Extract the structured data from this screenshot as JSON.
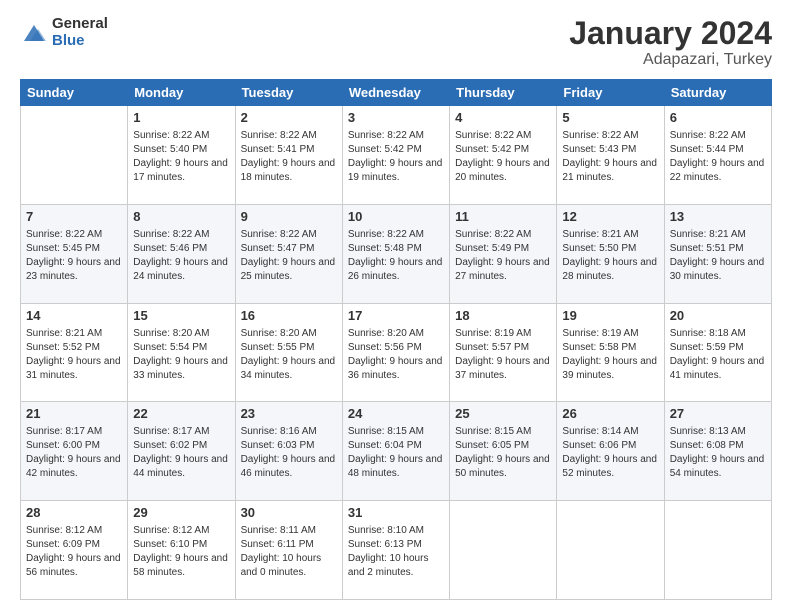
{
  "logo": {
    "general": "General",
    "blue": "Blue"
  },
  "title": {
    "month": "January 2024",
    "location": "Adapazari, Turkey"
  },
  "days": [
    "Sunday",
    "Monday",
    "Tuesday",
    "Wednesday",
    "Thursday",
    "Friday",
    "Saturday"
  ],
  "weeks": [
    [
      {
        "day": "",
        "sunrise": "",
        "sunset": "",
        "daylight": ""
      },
      {
        "day": "1",
        "sunrise": "Sunrise: 8:22 AM",
        "sunset": "Sunset: 5:40 PM",
        "daylight": "Daylight: 9 hours and 17 minutes."
      },
      {
        "day": "2",
        "sunrise": "Sunrise: 8:22 AM",
        "sunset": "Sunset: 5:41 PM",
        "daylight": "Daylight: 9 hours and 18 minutes."
      },
      {
        "day": "3",
        "sunrise": "Sunrise: 8:22 AM",
        "sunset": "Sunset: 5:42 PM",
        "daylight": "Daylight: 9 hours and 19 minutes."
      },
      {
        "day": "4",
        "sunrise": "Sunrise: 8:22 AM",
        "sunset": "Sunset: 5:42 PM",
        "daylight": "Daylight: 9 hours and 20 minutes."
      },
      {
        "day": "5",
        "sunrise": "Sunrise: 8:22 AM",
        "sunset": "Sunset: 5:43 PM",
        "daylight": "Daylight: 9 hours and 21 minutes."
      },
      {
        "day": "6",
        "sunrise": "Sunrise: 8:22 AM",
        "sunset": "Sunset: 5:44 PM",
        "daylight": "Daylight: 9 hours and 22 minutes."
      }
    ],
    [
      {
        "day": "7",
        "sunrise": "Sunrise: 8:22 AM",
        "sunset": "Sunset: 5:45 PM",
        "daylight": "Daylight: 9 hours and 23 minutes."
      },
      {
        "day": "8",
        "sunrise": "Sunrise: 8:22 AM",
        "sunset": "Sunset: 5:46 PM",
        "daylight": "Daylight: 9 hours and 24 minutes."
      },
      {
        "day": "9",
        "sunrise": "Sunrise: 8:22 AM",
        "sunset": "Sunset: 5:47 PM",
        "daylight": "Daylight: 9 hours and 25 minutes."
      },
      {
        "day": "10",
        "sunrise": "Sunrise: 8:22 AM",
        "sunset": "Sunset: 5:48 PM",
        "daylight": "Daylight: 9 hours and 26 minutes."
      },
      {
        "day": "11",
        "sunrise": "Sunrise: 8:22 AM",
        "sunset": "Sunset: 5:49 PM",
        "daylight": "Daylight: 9 hours and 27 minutes."
      },
      {
        "day": "12",
        "sunrise": "Sunrise: 8:21 AM",
        "sunset": "Sunset: 5:50 PM",
        "daylight": "Daylight: 9 hours and 28 minutes."
      },
      {
        "day": "13",
        "sunrise": "Sunrise: 8:21 AM",
        "sunset": "Sunset: 5:51 PM",
        "daylight": "Daylight: 9 hours and 30 minutes."
      }
    ],
    [
      {
        "day": "14",
        "sunrise": "Sunrise: 8:21 AM",
        "sunset": "Sunset: 5:52 PM",
        "daylight": "Daylight: 9 hours and 31 minutes."
      },
      {
        "day": "15",
        "sunrise": "Sunrise: 8:20 AM",
        "sunset": "Sunset: 5:54 PM",
        "daylight": "Daylight: 9 hours and 33 minutes."
      },
      {
        "day": "16",
        "sunrise": "Sunrise: 8:20 AM",
        "sunset": "Sunset: 5:55 PM",
        "daylight": "Daylight: 9 hours and 34 minutes."
      },
      {
        "day": "17",
        "sunrise": "Sunrise: 8:20 AM",
        "sunset": "Sunset: 5:56 PM",
        "daylight": "Daylight: 9 hours and 36 minutes."
      },
      {
        "day": "18",
        "sunrise": "Sunrise: 8:19 AM",
        "sunset": "Sunset: 5:57 PM",
        "daylight": "Daylight: 9 hours and 37 minutes."
      },
      {
        "day": "19",
        "sunrise": "Sunrise: 8:19 AM",
        "sunset": "Sunset: 5:58 PM",
        "daylight": "Daylight: 9 hours and 39 minutes."
      },
      {
        "day": "20",
        "sunrise": "Sunrise: 8:18 AM",
        "sunset": "Sunset: 5:59 PM",
        "daylight": "Daylight: 9 hours and 41 minutes."
      }
    ],
    [
      {
        "day": "21",
        "sunrise": "Sunrise: 8:17 AM",
        "sunset": "Sunset: 6:00 PM",
        "daylight": "Daylight: 9 hours and 42 minutes."
      },
      {
        "day": "22",
        "sunrise": "Sunrise: 8:17 AM",
        "sunset": "Sunset: 6:02 PM",
        "daylight": "Daylight: 9 hours and 44 minutes."
      },
      {
        "day": "23",
        "sunrise": "Sunrise: 8:16 AM",
        "sunset": "Sunset: 6:03 PM",
        "daylight": "Daylight: 9 hours and 46 minutes."
      },
      {
        "day": "24",
        "sunrise": "Sunrise: 8:15 AM",
        "sunset": "Sunset: 6:04 PM",
        "daylight": "Daylight: 9 hours and 48 minutes."
      },
      {
        "day": "25",
        "sunrise": "Sunrise: 8:15 AM",
        "sunset": "Sunset: 6:05 PM",
        "daylight": "Daylight: 9 hours and 50 minutes."
      },
      {
        "day": "26",
        "sunrise": "Sunrise: 8:14 AM",
        "sunset": "Sunset: 6:06 PM",
        "daylight": "Daylight: 9 hours and 52 minutes."
      },
      {
        "day": "27",
        "sunrise": "Sunrise: 8:13 AM",
        "sunset": "Sunset: 6:08 PM",
        "daylight": "Daylight: 9 hours and 54 minutes."
      }
    ],
    [
      {
        "day": "28",
        "sunrise": "Sunrise: 8:12 AM",
        "sunset": "Sunset: 6:09 PM",
        "daylight": "Daylight: 9 hours and 56 minutes."
      },
      {
        "day": "29",
        "sunrise": "Sunrise: 8:12 AM",
        "sunset": "Sunset: 6:10 PM",
        "daylight": "Daylight: 9 hours and 58 minutes."
      },
      {
        "day": "30",
        "sunrise": "Sunrise: 8:11 AM",
        "sunset": "Sunset: 6:11 PM",
        "daylight": "Daylight: 10 hours and 0 minutes."
      },
      {
        "day": "31",
        "sunrise": "Sunrise: 8:10 AM",
        "sunset": "Sunset: 6:13 PM",
        "daylight": "Daylight: 10 hours and 2 minutes."
      },
      {
        "day": "",
        "sunrise": "",
        "sunset": "",
        "daylight": ""
      },
      {
        "day": "",
        "sunrise": "",
        "sunset": "",
        "daylight": ""
      },
      {
        "day": "",
        "sunrise": "",
        "sunset": "",
        "daylight": ""
      }
    ]
  ]
}
